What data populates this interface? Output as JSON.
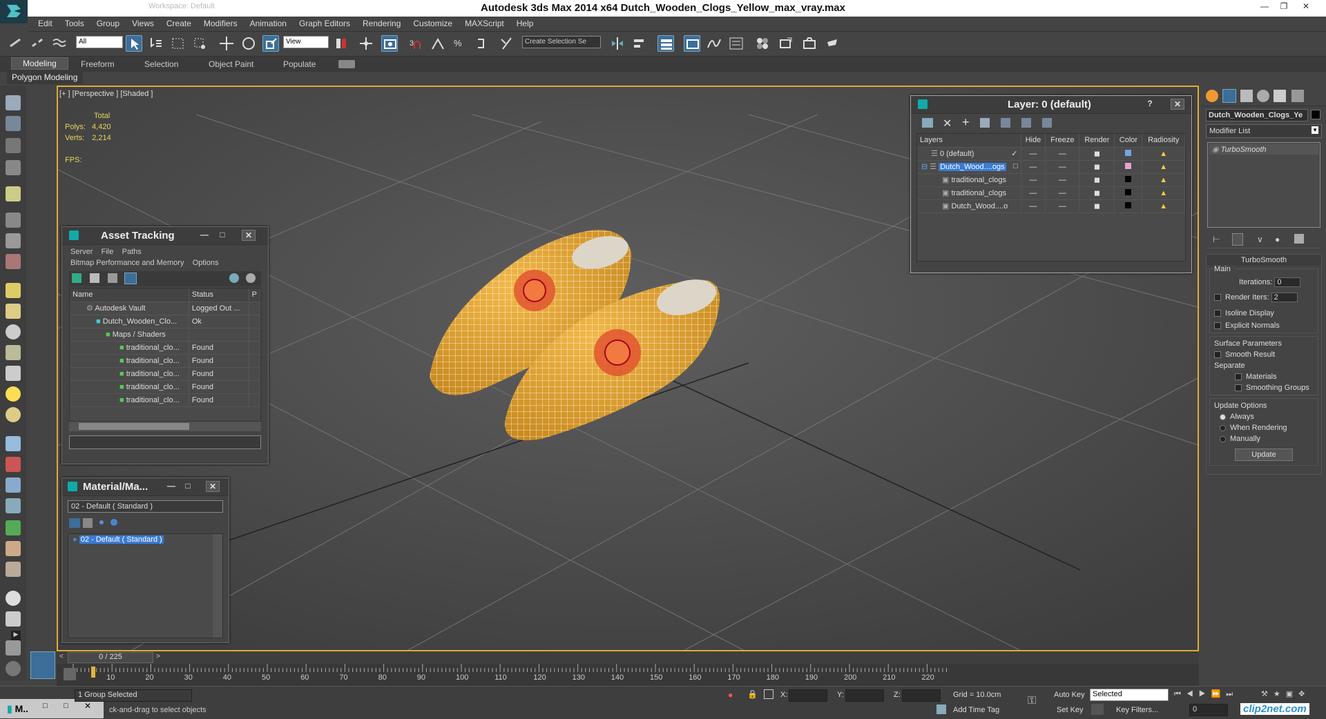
{
  "titlebar": {
    "search_text": "Workspace: Default",
    "title": "Autodesk 3ds Max  2014 x64      Dutch_Wooden_Clogs_Yellow_max_vray.max"
  },
  "menu": [
    "Edit",
    "Tools",
    "Group",
    "Views",
    "Create",
    "Modifiers",
    "Animation",
    "Graph Editors",
    "Rendering",
    "Customize",
    "MAXScript",
    "Help"
  ],
  "toolbar": {
    "filter": "All",
    "view": "View",
    "selection_set": "Create Selection Se"
  },
  "ribbon": {
    "tabs": [
      "Modeling",
      "Freeform",
      "Selection",
      "Object Paint",
      "Populate"
    ],
    "sub": "Polygon Modeling"
  },
  "viewport": {
    "label": "[+ ] [Perspective ] [Shaded ]",
    "stats_total": "Total",
    "polys_label": "Polys:",
    "polys": "4,420",
    "verts_label": "Verts:",
    "verts": "2,214",
    "fps_label": "FPS:"
  },
  "asset_tracking": {
    "title": "Asset Tracking",
    "menu1": [
      "Server",
      "File",
      "Paths"
    ],
    "menu2": [
      "Bitmap Performance and Memory",
      "Options"
    ],
    "col_name": "Name",
    "col_status": "Status",
    "col_p": "P",
    "rows": [
      {
        "name": "Autodesk Vault",
        "status": "Logged Out ..."
      },
      {
        "name": "Dutch_Wooden_Clo...",
        "status": "Ok"
      },
      {
        "name": "Maps / Shaders",
        "status": ""
      },
      {
        "name": "traditional_clo...",
        "status": "Found"
      },
      {
        "name": "traditional_clo...",
        "status": "Found"
      },
      {
        "name": "traditional_clo...",
        "status": "Found"
      },
      {
        "name": "traditional_clo...",
        "status": "Found"
      },
      {
        "name": "traditional_clo...",
        "status": "Found"
      }
    ]
  },
  "material": {
    "title": "Material/Ma...",
    "field": "02 - Default  ( Standard )",
    "item": "02 - Default  ( Standard )"
  },
  "layer": {
    "title": "Layer: 0 (default)",
    "help": "?",
    "cols": [
      "Layers",
      "Hide",
      "Freeze",
      "Render",
      "Color",
      "Radiosity"
    ],
    "rows": [
      {
        "name": "0 (default)",
        "color": "#6fa8dc"
      },
      {
        "name": "Dutch_Wood....ogs",
        "color": "#e7a0d0"
      },
      {
        "name": "traditional_clogs",
        "color": "#000000"
      },
      {
        "name": "traditional_clogs",
        "color": "#000000"
      },
      {
        "name": "Dutch_Wood....o",
        "color": "#000000"
      }
    ]
  },
  "command": {
    "object_name": "Dutch_Wooden_Clogs_Ye",
    "modifier_list": "Modifier List",
    "stack_item": "TurboSmooth",
    "rollout": "TurboSmooth",
    "main": "Main",
    "iterations_label": "Iterations:",
    "iterations": "0",
    "render_iters_label": "Render Iters:",
    "render_iters": "2",
    "isoline": "Isoline Display",
    "explicit": "Explicit Normals",
    "surface": "Surface Parameters",
    "smooth_result": "Smooth Result",
    "separate": "Separate",
    "materials": "Materials",
    "smoothing_groups": "Smoothing Groups",
    "update_options": "Update Options",
    "always": "Always",
    "when_rendering": "When Rendering",
    "manually": "Manually",
    "update_btn": "Update"
  },
  "timeline": {
    "frame": "0 / 225",
    "ticks": [
      "10",
      "20",
      "30",
      "40",
      "50",
      "60",
      "70",
      "80",
      "90",
      "100",
      "110",
      "120",
      "130",
      "140",
      "150",
      "160",
      "170",
      "180",
      "190",
      "200",
      "210",
      "220"
    ]
  },
  "status": {
    "max_label": "M..",
    "group_selected": "1 Group Selected",
    "prompt": "ck-and-drag to select objects",
    "x": "X:",
    "y": "Y:",
    "z": "Z:",
    "grid": "Grid = 10.0cm",
    "add_time_tag": "Add Time Tag",
    "auto_key": "Auto Key",
    "set_key": "Set Key",
    "key_mode": "Selected",
    "key_filters": "Key Filters...",
    "frame_field": "0",
    "watermark": "clip2net.com"
  }
}
